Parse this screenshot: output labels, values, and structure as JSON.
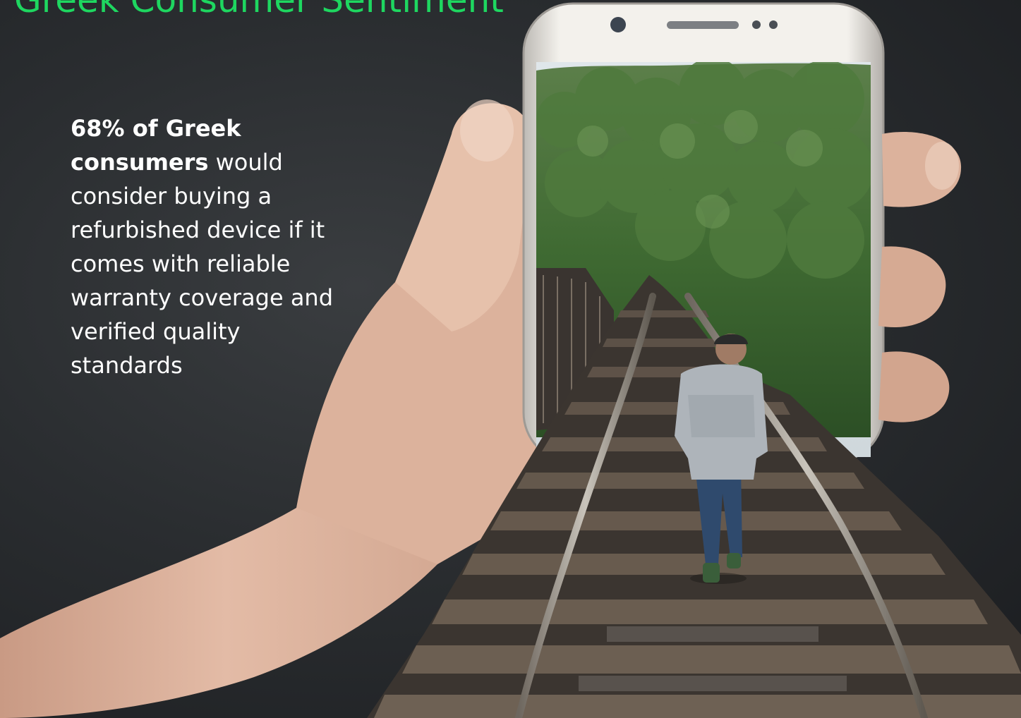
{
  "header": {
    "title": "Greek Consumer Sentiment"
  },
  "stat": {
    "highlight": "68% of Greek consumers",
    "body": " would consider buying a refurbished device if it comes with reliable warranty coverage and verified quality standards"
  },
  "colors": {
    "accent": "#1ed760",
    "background": "#2a2d30",
    "text": "#ffffff"
  }
}
